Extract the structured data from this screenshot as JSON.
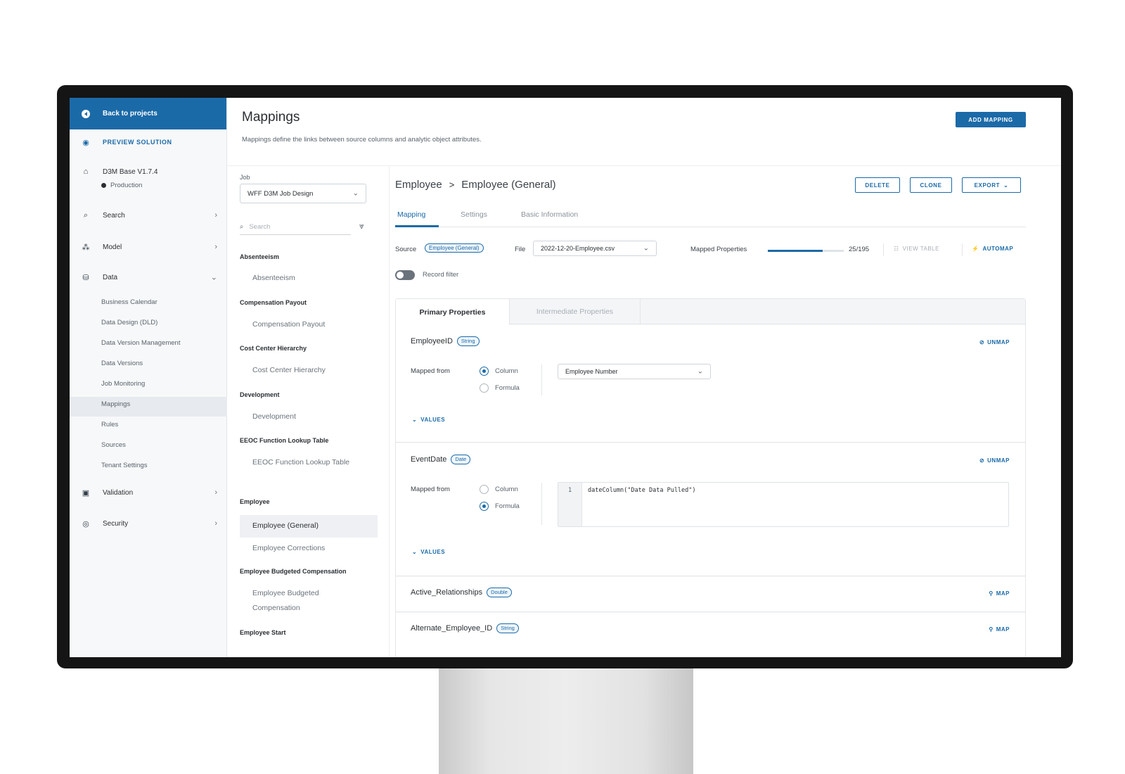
{
  "sidebar": {
    "back_label": "Back to projects",
    "preview_label": "PREVIEW SOLUTION",
    "project_name": "D3M Base V1.7.4",
    "environment": "Production",
    "nav": {
      "search": "Search",
      "model": "Model",
      "data": "Data",
      "validation": "Validation",
      "security": "Security"
    },
    "data_items": [
      "Business Calendar",
      "Data Design (DLD)",
      "Data Version Management",
      "Data Versions",
      "Job Monitoring",
      "Mappings",
      "Rules",
      "Sources",
      "Tenant Settings"
    ],
    "selected_item": "Mappings"
  },
  "header": {
    "title": "Mappings",
    "subtitle": "Mappings define the links between source columns and analytic object attributes.",
    "add_button": "ADD MAPPING"
  },
  "list": {
    "job_label": "Job",
    "job_value": "WFF D3M Job Design",
    "search_placeholder": "Search",
    "groups": [
      {
        "name": "Absenteeism",
        "items": [
          "Absenteeism"
        ]
      },
      {
        "name": "Compensation Payout",
        "items": [
          "Compensation Payout"
        ]
      },
      {
        "name": "Cost Center Hierarchy",
        "items": [
          "Cost Center Hierarchy"
        ]
      },
      {
        "name": "Development",
        "items": [
          "Development"
        ]
      },
      {
        "name": "EEOC Function Lookup Table",
        "items": [
          "EEOC Function Lookup Table"
        ]
      },
      {
        "name": "Employee",
        "items": [
          "Employee (General)",
          "Employee Corrections"
        ]
      },
      {
        "name": "Employee Budgeted Compensation",
        "items": [
          "Employee Budgeted Compensation"
        ]
      },
      {
        "name": "Employee Start",
        "items": []
      }
    ],
    "selected": "Employee (General)"
  },
  "detail": {
    "breadcrumb_parent": "Employee",
    "breadcrumb_sep": ">",
    "breadcrumb_current": "Employee (General)",
    "actions": {
      "delete": "DELETE",
      "clone": "CLONE",
      "export": "EXPORT"
    },
    "tabs": [
      "Mapping",
      "Settings",
      "Basic Information"
    ],
    "active_tab": "Mapping",
    "source_label": "Source",
    "source_value": "Employee (General)",
    "file_label": "File",
    "file_value": "2022-12-20-Employee.csv",
    "mapped_label": "Mapped Properties",
    "mapped_count": "25/195",
    "mapped_fraction": 0.72,
    "view_table": "VIEW TABLE",
    "automap": "AUTOMAP",
    "record_filter": "Record filter",
    "record_filter_on": false
  },
  "properties": {
    "tabs": [
      "Primary Properties",
      "Intermediate Properties"
    ],
    "active_tab": "Primary Properties",
    "mapped_from_label": "Mapped from",
    "column_label": "Column",
    "formula_label": "Formula",
    "values_label": "VALUES",
    "unmap_label": "UNMAP",
    "map_label": "MAP",
    "items": [
      {
        "name": "EmployeeID",
        "type": "String",
        "mode": "column",
        "column_value": "Employee Number"
      },
      {
        "name": "EventDate",
        "type": "Date",
        "mode": "formula",
        "line_no": "1",
        "formula": "dateColumn(\"Date Data Pulled\")"
      },
      {
        "name": "Active_Relationships",
        "type": "Double"
      },
      {
        "name": "Alternate_Employee_ID",
        "type": "String"
      }
    ]
  },
  "colors": {
    "accent": "#1b6aa8",
    "sidebar_bg": "#f7f8f9",
    "text": "#2b2f33"
  }
}
